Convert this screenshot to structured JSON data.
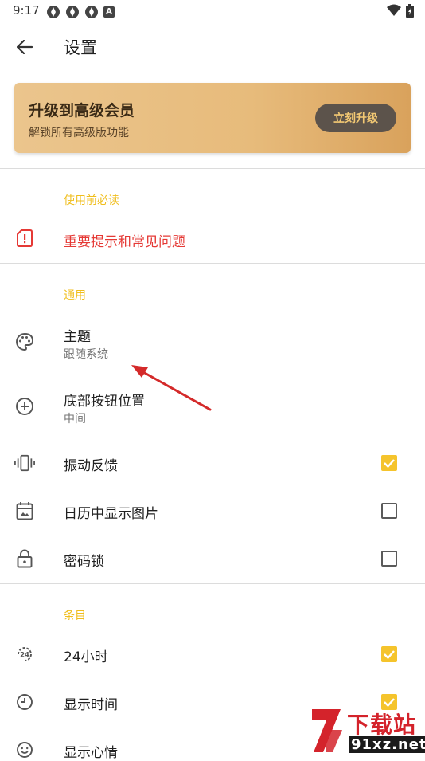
{
  "status_bar": {
    "time": "9:17",
    "app_badge": "A"
  },
  "app_bar": {
    "title": "设置"
  },
  "promo": {
    "title": "升级到高级会员",
    "subtitle": "解锁所有高级版功能",
    "button_label": "立刻升级"
  },
  "sections": {
    "must_read": {
      "header": "使用前必读",
      "faq_label": "重要提示和常见问题"
    },
    "general": {
      "header": "通用",
      "theme_label": "主题",
      "theme_value": "跟随系统",
      "button_position_label": "底部按钮位置",
      "button_position_value": "中间",
      "vibration_label": "振动反馈",
      "vibration_checked": true,
      "calendar_images_label": "日历中显示图片",
      "calendar_images_checked": false,
      "passcode_label": "密码锁",
      "passcode_checked": false
    },
    "entries": {
      "header": "条目",
      "hour24_label": "24小时",
      "hour24_checked": true,
      "show_time_label": "显示时间",
      "show_time_checked": true,
      "show_mood_label": "显示心情"
    }
  },
  "watermark": {
    "line1": "下载站",
    "line2": "91xz.net"
  },
  "colors": {
    "accent": "#f5c42c",
    "section_header": "#f0be1c",
    "danger": "#e53935",
    "promo_button_bg": "#5c534b",
    "promo_button_text": "#f2c873"
  }
}
